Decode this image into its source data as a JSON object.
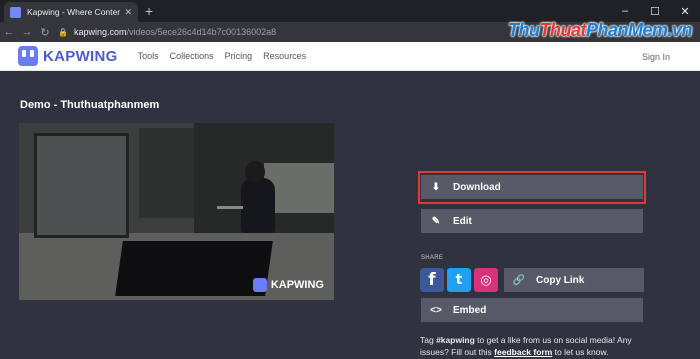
{
  "browser": {
    "tab_title": "Kapwing - Where Content Creati",
    "new_tab_label": "+",
    "url_host": "kapwing.com",
    "url_path": "/videos/5ece26c4d14b7c00136002a8",
    "window_controls": [
      "–",
      "☐",
      "✕"
    ]
  },
  "site_watermark": {
    "part1": "Thu",
    "part2": "Thuat",
    "part3": "PhanMem",
    "suffix": ".vn"
  },
  "navbar": {
    "logo_text": "KAPWING",
    "links": [
      "Tools",
      "Collections",
      "Pricing",
      "Resources"
    ],
    "sign_in": "Sign In"
  },
  "page": {
    "title": "Demo - Thuthuatphanmem",
    "video_watermark": "KAPWING"
  },
  "actions": {
    "download": "Download",
    "edit": "Edit",
    "share_label": "SHARE",
    "copy_link": "Copy Link",
    "embed": "Embed"
  },
  "social": {
    "facebook": "f",
    "twitter": "t",
    "instagram": "◎"
  },
  "footer_text": {
    "prefix": "Tag ",
    "hashtag": "#kapwing",
    "middle": " to get a like from us on social media! Any issues? Fill out this ",
    "link": "feedback form",
    "suffix": " to let us know."
  },
  "colors": {
    "page_bg": "#2f3340",
    "button_bg": "#555a66",
    "highlight": "#e53935",
    "brand": "#6a7cf2"
  }
}
